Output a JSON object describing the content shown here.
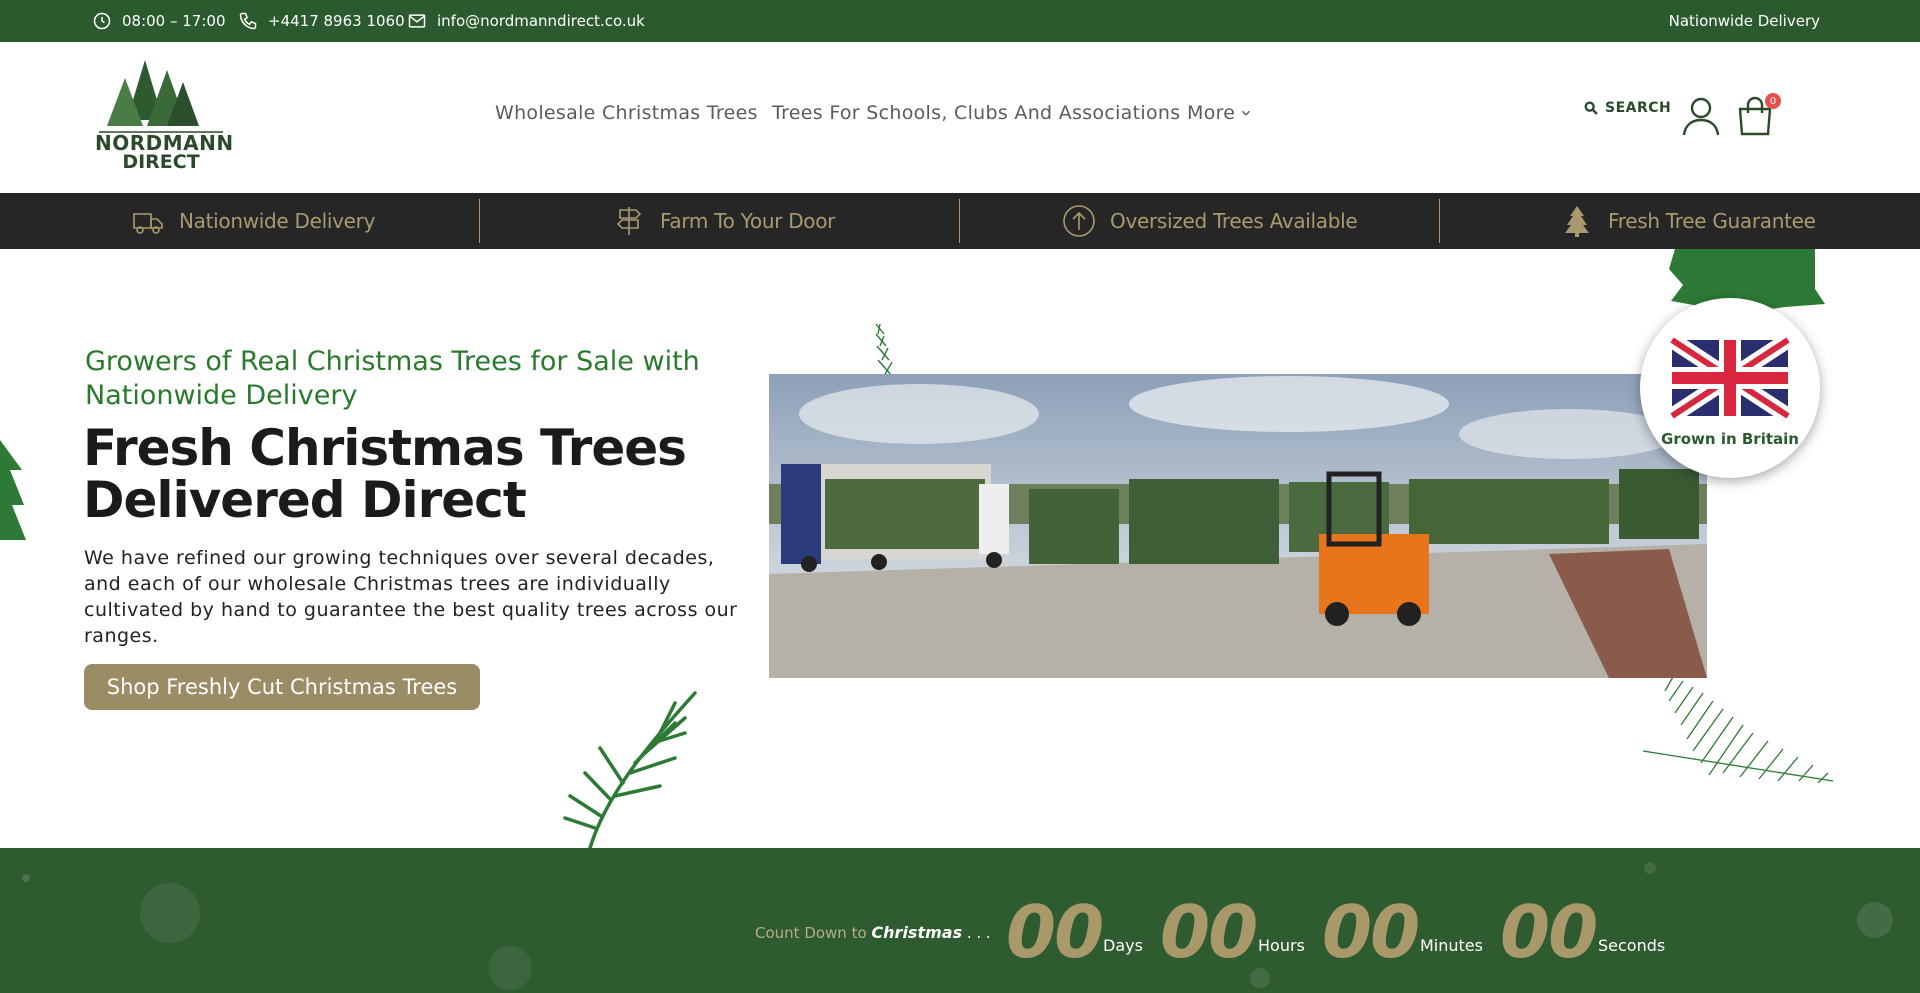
{
  "topbar": {
    "hours": "08:00 – 17:00",
    "phone": "+4417 8963 1060",
    "email": "info@nordmanndirect.co.uk",
    "right_text": "Nationwide Delivery"
  },
  "logo": {
    "line1": "NORDMANN",
    "line2": "DIRECT"
  },
  "nav": {
    "items": [
      "Wholesale Christmas Trees",
      "Trees For Schools, Clubs And Associations",
      "More"
    ]
  },
  "search_label": "SEARCH",
  "cart_count": "0",
  "features": [
    "Nationwide Delivery",
    "Farm To Your Door",
    "Oversized Trees Available",
    "Fresh Tree Guarantee"
  ],
  "hero": {
    "subtitle": "Growers of Real Christmas Trees for Sale with Nationwide Delivery",
    "title": "Fresh Christmas Trees Delivered Direct",
    "description": "We have refined our growing techniques over several decades, and each of our wholesale Christmas trees are individually cultivated by hand to guarantee the best quality trees across our ranges.",
    "button": "Shop Freshly Cut Christmas Trees"
  },
  "badge": {
    "text": "Grown in Britain"
  },
  "countdown": {
    "label_prefix": "Count Down to ",
    "label_em": "Christmas",
    "label_suffix": " . . .",
    "days": "00",
    "days_label": "Days",
    "hours": "00",
    "hours_label": "Hours",
    "minutes": "00",
    "minutes_label": "Minutes",
    "seconds": "00",
    "seconds_label": "Seconds"
  },
  "colors": {
    "brand_green": "#2b5a2e",
    "accent_gold": "#9a8c64",
    "dark_bar": "#262626",
    "badge_red": "#e94e4e"
  }
}
